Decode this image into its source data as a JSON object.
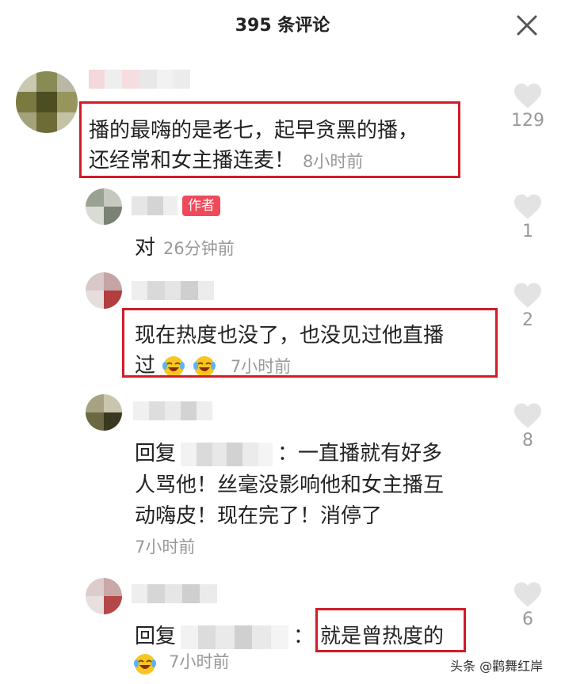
{
  "header": {
    "title": "395 条评论",
    "close_icon": "close-icon"
  },
  "comments": [
    {
      "text_line1": "播的最嗨的是老七，起早贪黑的播，",
      "text_line2": "还经常和女主播连麦！",
      "time": "8小时前",
      "likes": "129"
    },
    {
      "author_tag": "作者",
      "text": "对",
      "time": "26分钟前",
      "likes": "1"
    },
    {
      "text_line1": "现在热度也没了，也没见过他直播",
      "text_line2": "过",
      "time": "7小时前",
      "likes": "2"
    },
    {
      "reply_prefix": "回复",
      "reply_sep": "：",
      "text_line1": "一直播就有好多",
      "text_line2": "人骂他！丝毫没影响他和女主播互",
      "text_line3": "动嗨皮！现在完了！消停了",
      "time": "7小时前",
      "likes": "8"
    },
    {
      "reply_prefix": "回复",
      "reply_sep": "：",
      "text": "就是曾热度的",
      "time": "7小时前",
      "likes": "6"
    }
  ],
  "watermark": "头条 @鹳舞红岸",
  "colors": {
    "highlight_box": "#d21b2a",
    "author_tag": "#f04a5a",
    "meta_text": "#999999",
    "like_icon": "#e3e3e3"
  }
}
